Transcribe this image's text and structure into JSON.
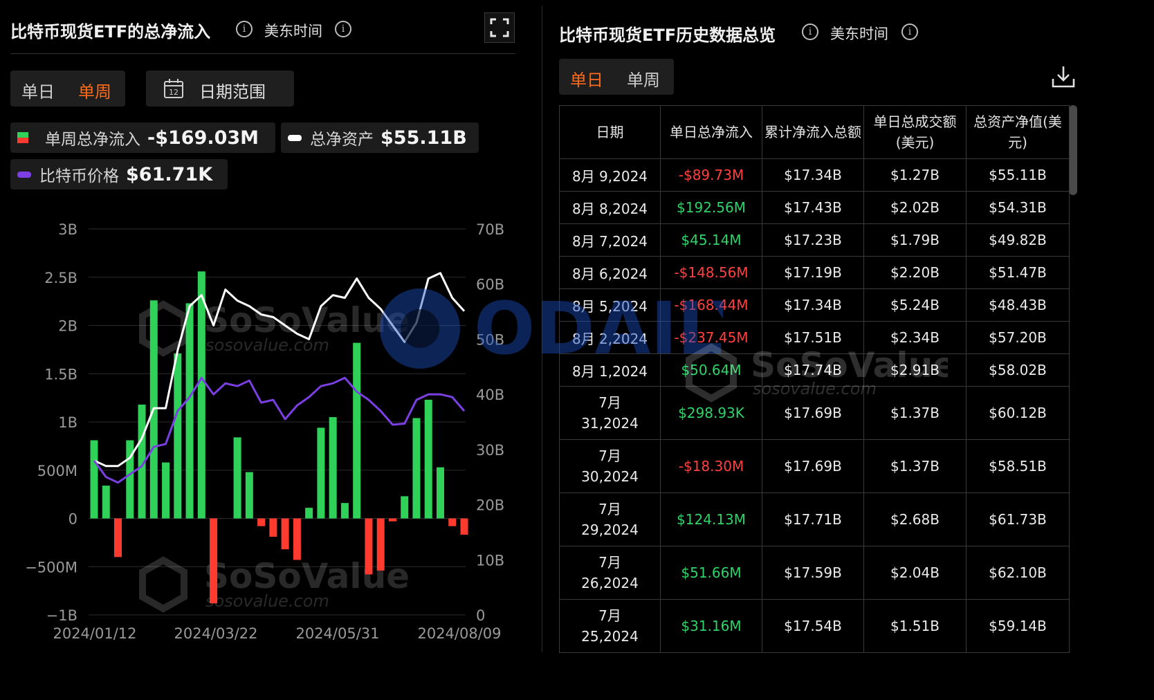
{
  "left_panel": {
    "title": "比特币现货ETF的总净流入",
    "timezone": "美东时间",
    "tabs": [
      "单日",
      "单周"
    ],
    "active_tab": "单周",
    "date_range_label": "日期范围",
    "calendar_day": "12",
    "legend": [
      {
        "label": "单周总净流入",
        "value": "-$169.03M",
        "icon": "green-red-square"
      },
      {
        "label": "总净资产",
        "value": "$55.11B",
        "color": "#ffffff"
      },
      {
        "label": "比特币价格",
        "value": "$61.71K",
        "color": "#7b3fe4"
      }
    ]
  },
  "chart_data": {
    "type": "bar",
    "left_axis": {
      "ticks": [
        "3B",
        "2.5B",
        "2B",
        "1.5B",
        "1B",
        "500M",
        "0",
        "−500M",
        "−1B"
      ],
      "ylim": [
        -1000,
        3000
      ],
      "unit": "M"
    },
    "right_axis": {
      "ticks": [
        "70B",
        "60B",
        "50B",
        "40B",
        "30B",
        "20B",
        "10B",
        "0"
      ],
      "ylim": [
        0,
        70
      ],
      "unit": "B"
    },
    "x_ticks": [
      "2024/01/12",
      "2024/03/22",
      "2024/05/31",
      "2024/08/09"
    ],
    "grid": true,
    "colors": {
      "inflow": "#30d158",
      "outflow": "#ff3b30",
      "net_assets": "#ffffff",
      "btc_price": "#7b3fe4"
    },
    "series": [
      {
        "name": "单周总净流入",
        "type": "bar",
        "values": [
          810,
          340,
          -400,
          810,
          1180,
          2260,
          580,
          1710,
          2230,
          2560,
          -880,
          0,
          840,
          480,
          -80,
          -190,
          -320,
          -430,
          110,
          940,
          1050,
          160,
          1820,
          -580,
          -540,
          -30,
          230,
          1040,
          1230,
          530,
          -80,
          -169.03
        ]
      },
      {
        "name": "总净资产",
        "type": "line",
        "values": [
          28,
          27,
          27,
          28.5,
          32,
          37.5,
          37.5,
          48,
          56,
          58,
          52.5,
          59,
          57,
          56,
          54.5,
          54,
          52.5,
          51,
          50,
          56,
          58,
          57.5,
          61,
          57.5,
          55.5,
          52.5,
          49.5,
          53,
          61,
          62,
          57.5,
          55.11
        ]
      },
      {
        "name": "比特币价格",
        "type": "line",
        "values": [
          28,
          25,
          24,
          25.5,
          27,
          30.5,
          31,
          37,
          39.5,
          43,
          40,
          42,
          41.5,
          42.5,
          38.5,
          39,
          35.5,
          38,
          39.5,
          41.5,
          42,
          43,
          40.5,
          39,
          37,
          34.5,
          34.7,
          39,
          40,
          40,
          39.5,
          37
        ]
      }
    ]
  },
  "right_panel": {
    "title": "比特币现货ETF历史数据总览",
    "timezone": "美东时间",
    "tabs": [
      "单日",
      "单周"
    ],
    "active_tab": "单日",
    "columns": [
      "日期",
      "单日总净流入",
      "累计净流入总额",
      "单日总成交额(美元)",
      "总资产净值(美元)"
    ],
    "rows": [
      {
        "date": "8月 9,2024",
        "net_inflow": "-$89.73M",
        "cumulative": "$17.34B",
        "volume": "$1.27B",
        "net_assets": "$55.11B",
        "sign": "neg"
      },
      {
        "date": "8月 8,2024",
        "net_inflow": "$192.56M",
        "cumulative": "$17.43B",
        "volume": "$2.02B",
        "net_assets": "$54.31B",
        "sign": "pos"
      },
      {
        "date": "8月 7,2024",
        "net_inflow": "$45.14M",
        "cumulative": "$17.23B",
        "volume": "$1.79B",
        "net_assets": "$49.82B",
        "sign": "pos"
      },
      {
        "date": "8月 6,2024",
        "net_inflow": "-$148.56M",
        "cumulative": "$17.19B",
        "volume": "$2.20B",
        "net_assets": "$51.47B",
        "sign": "neg"
      },
      {
        "date": "8月 5,2024",
        "net_inflow": "-$168.44M",
        "cumulative": "$17.34B",
        "volume": "$5.24B",
        "net_assets": "$48.43B",
        "sign": "neg"
      },
      {
        "date": "8月 2,2024",
        "net_inflow": "-$237.45M",
        "cumulative": "$17.51B",
        "volume": "$2.34B",
        "net_assets": "$57.20B",
        "sign": "neg"
      },
      {
        "date": "8月 1,2024",
        "net_inflow": "$50.64M",
        "cumulative": "$17.74B",
        "volume": "$2.91B",
        "net_assets": "$58.02B",
        "sign": "pos"
      },
      {
        "date": "7月 31,2024",
        "net_inflow": "$298.93K",
        "cumulative": "$17.69B",
        "volume": "$1.37B",
        "net_assets": "$60.12B",
        "sign": "pos"
      },
      {
        "date": "7月 30,2024",
        "net_inflow": "-$18.30M",
        "cumulative": "$17.69B",
        "volume": "$1.37B",
        "net_assets": "$58.51B",
        "sign": "neg"
      },
      {
        "date": "7月 29,2024",
        "net_inflow": "$124.13M",
        "cumulative": "$17.71B",
        "volume": "$2.68B",
        "net_assets": "$61.73B",
        "sign": "pos"
      },
      {
        "date": "7月 26,2024",
        "net_inflow": "$51.66M",
        "cumulative": "$17.59B",
        "volume": "$2.04B",
        "net_assets": "$62.10B",
        "sign": "pos"
      },
      {
        "date": "7月 25,2024",
        "net_inflow": "$31.16M",
        "cumulative": "$17.54B",
        "volume": "$1.51B",
        "net_assets": "$59.14B",
        "sign": "pos"
      }
    ]
  },
  "watermarks": {
    "soso_name": "SoSoValue",
    "soso_url": "sosovalue.com",
    "odaily": "ODAILY"
  },
  "icons": {
    "info": "info-icon",
    "fullscreen": "fullscreen-icon",
    "calendar": "calendar-icon",
    "download": "download-icon"
  }
}
